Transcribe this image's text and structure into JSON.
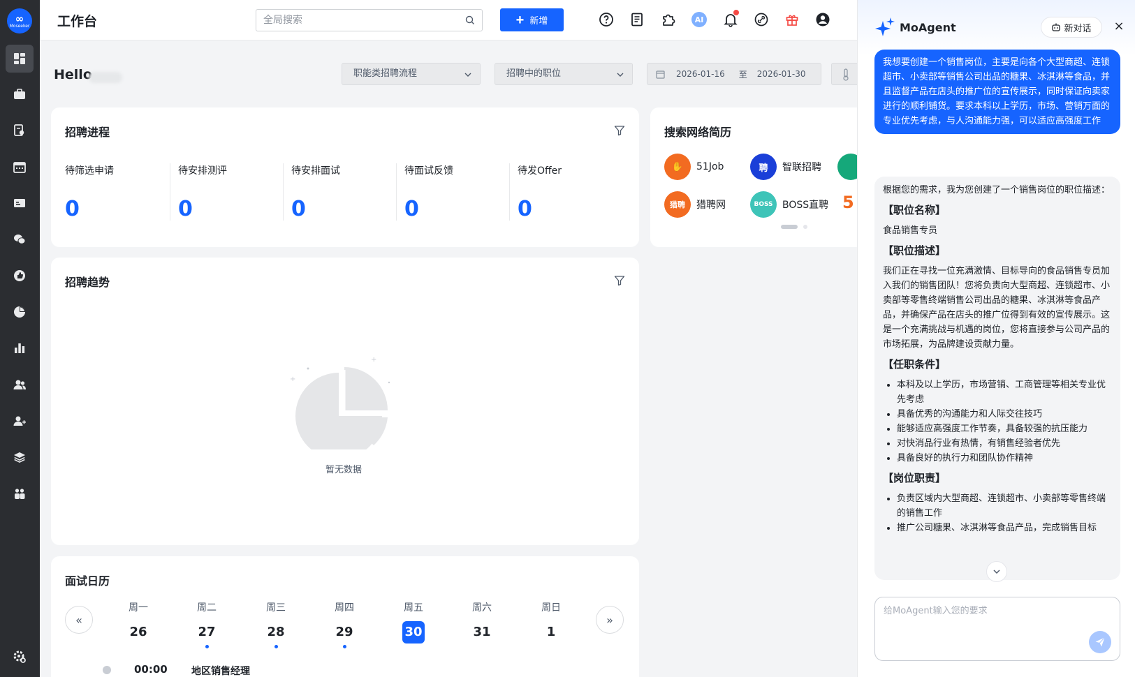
{
  "app": {
    "logo_text": "Moseeker",
    "page_title": "工作台"
  },
  "colors": {
    "primary": "#1664ff",
    "rail_bg": "#2b2d31",
    "page_bg": "#f3f4f6"
  },
  "rail": {
    "items": [
      {
        "icon": "dashboard-icon",
        "active": true
      },
      {
        "icon": "briefcase-icon",
        "active": false
      },
      {
        "icon": "resume-search-icon",
        "active": false
      },
      {
        "icon": "calendar-icon",
        "active": false
      },
      {
        "icon": "id-card-icon",
        "active": false
      },
      {
        "icon": "wechat-icon",
        "active": false
      },
      {
        "icon": "thumbs-up-icon",
        "active": false
      },
      {
        "icon": "pie-chart-icon",
        "active": false
      },
      {
        "icon": "bar-chart-icon",
        "active": false
      },
      {
        "icon": "people-icon",
        "active": false
      },
      {
        "icon": "user-add-icon",
        "active": false
      },
      {
        "icon": "layers-icon",
        "active": false
      },
      {
        "icon": "team-icon",
        "active": false
      }
    ],
    "settings_icon": "settings-icon"
  },
  "topbar": {
    "search_placeholder": "全局搜索",
    "add_label": "新增",
    "ai_label": "AI",
    "icons": [
      "help-icon",
      "document-icon",
      "plugin-icon",
      "ai-icon",
      "bell-icon",
      "link-icon",
      "gift-icon",
      "account-icon"
    ]
  },
  "filters": {
    "hello": "Hello",
    "process": "职能类招聘流程",
    "position": "招聘中的职位",
    "date_from": "2026-01-16",
    "date_sep": "至",
    "date_to": "2026-01-30"
  },
  "progress": {
    "title": "招聘进程",
    "stages": [
      {
        "label": "待筛选申请",
        "value": "0"
      },
      {
        "label": "待安排测评",
        "value": "0"
      },
      {
        "label": "待安排面试",
        "value": "0"
      },
      {
        "label": "待面试反馈",
        "value": "0"
      },
      {
        "label": "待发Offer",
        "value": "0"
      }
    ]
  },
  "resume_search": {
    "title": "搜索网络简历",
    "sites": [
      {
        "name": "51Job",
        "mark": "✋",
        "color": "#f26b21"
      },
      {
        "name": "智联招聘",
        "mark": "聘",
        "color": "#1a3fd8"
      },
      {
        "name": "猎聘网",
        "mark": "猎聘",
        "color": "#f26b21"
      },
      {
        "name": "BOSS直聘",
        "mark": "BOSS",
        "color": "#3ec4b8"
      }
    ],
    "page": 1,
    "pages": 2
  },
  "trend": {
    "title": "招聘趋势",
    "empty_text": "暂无数据"
  },
  "calendar": {
    "title": "面试日历",
    "prev": "«",
    "next": "»",
    "days": [
      {
        "name": "周一",
        "date": "26",
        "has_event": false,
        "today": false
      },
      {
        "name": "周二",
        "date": "27",
        "has_event": true,
        "today": false
      },
      {
        "name": "周三",
        "date": "28",
        "has_event": true,
        "today": false
      },
      {
        "name": "周四",
        "date": "29",
        "has_event": true,
        "today": false
      },
      {
        "name": "周五",
        "date": "30",
        "has_event": false,
        "today": true
      },
      {
        "name": "周六",
        "date": "31",
        "has_event": false,
        "today": false
      },
      {
        "name": "周日",
        "date": "1",
        "has_event": false,
        "today": false
      }
    ],
    "event": {
      "time": "00:00",
      "title": "地区销售经理"
    }
  },
  "agent": {
    "name": "MoAgent",
    "new_chat": "新对话",
    "close": "×",
    "user_message": "我想要创建一个销售岗位，主要是向各个大型商超、连锁超市、小卖部等销售公司出品的糖果、冰淇淋等食品，并且监督产品在店头的推广位的宣传展示，同时保证向卖家进行的顺利铺货。要求本科以上学历，市场、营销万面的专业优先考虑，与人沟通能力强，可以适应高强度工作",
    "reply": {
      "intro": "根据您的需求，我为您创建了一个销售岗位的职位描述：",
      "h_name": "【职位名称】",
      "name": "食品销售专员",
      "h_desc": "【职位描述】",
      "desc": "我们正在寻找一位充满激情、目标导向的食品销售专员加入我们的销售团队！您将负责向大型商超、连锁超市、小卖部等零售终端销售公司出品的糖果、冰淇淋等食品产品，并确保产品在店头的推广位得到有效的宣传展示。这是一个充满挑战与机遇的岗位，您将直接参与公司产品的市场拓展，为品牌建设贡献力量。",
      "h_req": "【任职条件】",
      "requirements": [
        "本科及以上学历，市场营销、工商管理等相关专业优先考虑",
        "具备优秀的沟通能力和人际交往技巧",
        "能够适应高强度工作节奏，具备较强的抗压能力",
        "对快消品行业有热情，有销售经验者优先",
        "具备良好的执行力和团队协作精神"
      ],
      "h_duty": "【岗位职责】",
      "duties": [
        "负责区域内大型商超、连锁超市、小卖部等零售终端的销售工作",
        "推广公司糖果、冰淇淋等食品产品，完成销售目标"
      ]
    },
    "input_placeholder": "给MoAgent输入您的要求"
  }
}
